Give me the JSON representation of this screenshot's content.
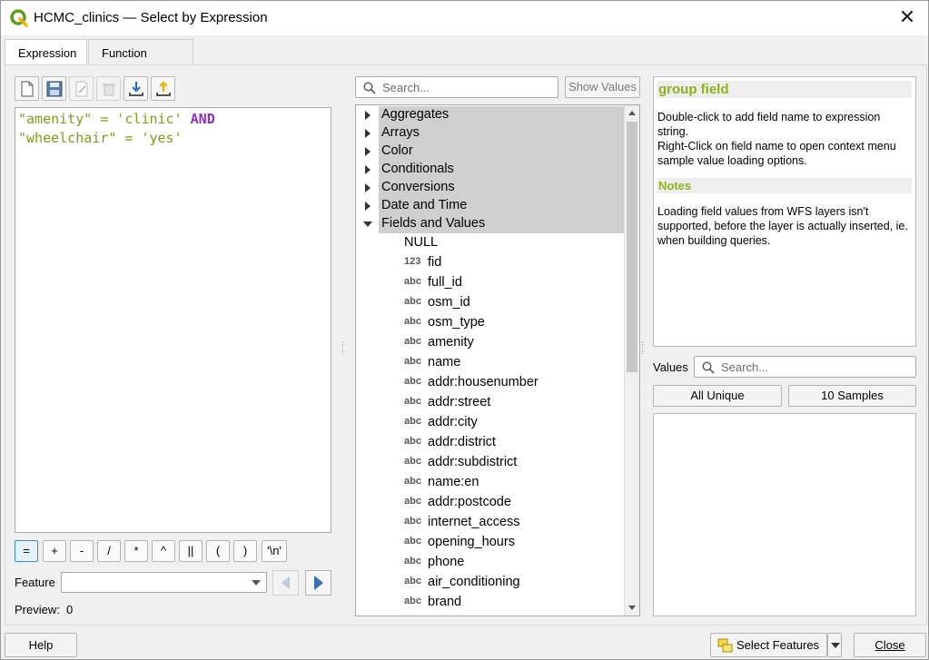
{
  "window": {
    "title": "HCMC_clinics — Select by Expression"
  },
  "tabs": [
    {
      "label": "Expression"
    },
    {
      "label": "Function Editor"
    }
  ],
  "expression": {
    "line1": [
      {
        "t": "\"amenity\" = 'clinic' ",
        "c": "str"
      },
      {
        "t": "AND",
        "c": "kw"
      }
    ],
    "line2": [
      {
        "t": "\"wheelchair\" = 'yes'",
        "c": "str"
      }
    ]
  },
  "expr_line1_str": "\"amenity\" = 'clinic' ",
  "expr_line1_kw": "AND",
  "expr_line2_str": "\"wheelchair\" = 'yes'",
  "operators": [
    "=",
    "+",
    "-",
    "/",
    "*",
    "^",
    "||",
    "(",
    ")",
    "'\\n'"
  ],
  "feature": {
    "label": "Feature",
    "value": ""
  },
  "preview": {
    "label": "Preview:",
    "value": "0"
  },
  "search": {
    "placeholder": "Search...",
    "show_values": "Show Values"
  },
  "groups": [
    "Aggregates",
    "Arrays",
    "Color",
    "Conditionals",
    "Conversions",
    "Date and Time",
    "Fields and Values"
  ],
  "fields": [
    {
      "type": "",
      "name": "NULL"
    },
    {
      "type": "123",
      "name": "fid"
    },
    {
      "type": "abc",
      "name": "full_id"
    },
    {
      "type": "abc",
      "name": "osm_id"
    },
    {
      "type": "abc",
      "name": "osm_type"
    },
    {
      "type": "abc",
      "name": "amenity"
    },
    {
      "type": "abc",
      "name": "name"
    },
    {
      "type": "abc",
      "name": "addr:housenumber"
    },
    {
      "type": "abc",
      "name": "addr:street"
    },
    {
      "type": "abc",
      "name": "addr:city"
    },
    {
      "type": "abc",
      "name": "addr:district"
    },
    {
      "type": "abc",
      "name": "addr:subdistrict"
    },
    {
      "type": "abc",
      "name": "name:en"
    },
    {
      "type": "abc",
      "name": "addr:postcode"
    },
    {
      "type": "abc",
      "name": "internet_access"
    },
    {
      "type": "abc",
      "name": "opening_hours"
    },
    {
      "type": "abc",
      "name": "phone"
    },
    {
      "type": "abc",
      "name": "air_conditioning"
    },
    {
      "type": "abc",
      "name": "brand"
    }
  ],
  "help": {
    "heading": "group field",
    "line1": "Double-click to add field name to expression string.",
    "line2": "Right-Click on field name to open context menu sample value loading options.",
    "notes_heading": "Notes",
    "notes": "Loading field values from WFS layers isn't supported, before the layer is actually inserted, ie. when building queries."
  },
  "values": {
    "label": "Values",
    "placeholder": "Search...",
    "all_unique": "All Unique",
    "samples": "10 Samples"
  },
  "footer": {
    "help": "Help",
    "select_features": "Select Features",
    "close": "Close"
  },
  "colors": {
    "accent_green": "#8cb21a",
    "string_green": "#7e9e1a",
    "keyword_purple": "#8c2ec4",
    "group_bg": "#cfcfcf"
  }
}
